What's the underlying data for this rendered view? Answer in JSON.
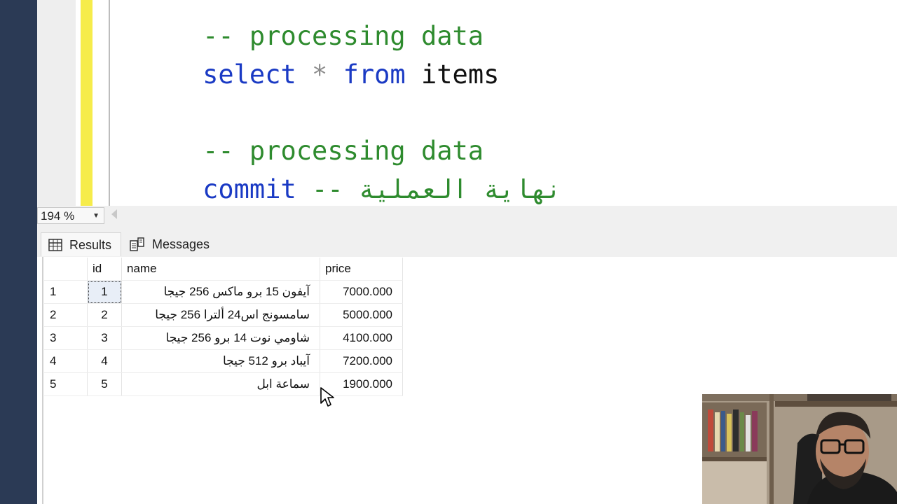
{
  "editor": {
    "line1": {
      "comment": "-- processing data"
    },
    "line2": {
      "kw1": "select",
      "op": "*",
      "kw2": "from",
      "table": "items"
    },
    "line3": {
      "comment": "-- processing data"
    },
    "line4": {
      "kw": "commit",
      "comment": "-- نهاية العملية"
    }
  },
  "zoom": {
    "value": "194 %"
  },
  "tabs": {
    "results": "Results",
    "messages": "Messages"
  },
  "grid": {
    "columns": [
      "id",
      "name",
      "price"
    ],
    "rows": [
      {
        "rownum": "1",
        "id": "1",
        "name": "آيفون 15 برو ماكس 256 جيجا",
        "price": "7000.000"
      },
      {
        "rownum": "2",
        "id": "2",
        "name": "سامسونج اس24 ألترا 256 جيجا",
        "price": "5000.000"
      },
      {
        "rownum": "3",
        "id": "3",
        "name": "شاومي نوت 14 برو 256 جيجا",
        "price": "4100.000"
      },
      {
        "rownum": "4",
        "id": "4",
        "name": "آيباد برو 512 جيجا",
        "price": "7200.000"
      },
      {
        "rownum": "5",
        "id": "5",
        "name": "سماعة ابل",
        "price": "1900.000"
      }
    ]
  },
  "colors": {
    "keyword": "#1a3ac4",
    "comment": "#2e8b2e",
    "change_bar": "#f6ec4a"
  }
}
